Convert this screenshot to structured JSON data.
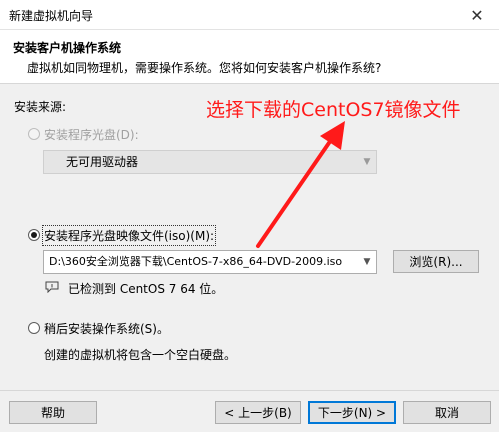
{
  "window": {
    "title": "新建虚拟机向导",
    "close_glyph": "✕"
  },
  "header": {
    "title": "安装客户机操作系统",
    "subtitle": "虚拟机如同物理机，需要操作系统。您将如何安装客户机操作系统?"
  },
  "source_label": "安装来源:",
  "options": {
    "disc": {
      "label": "安装程序光盘(D):",
      "dropdown_value": "无可用驱动器",
      "enabled": false
    },
    "iso": {
      "label": "安装程序光盘映像文件(iso)(M):",
      "path_value": "D:\\360安全浏览器下载\\CentOS-7-x86_64-DVD-2009.iso",
      "browse_label": "浏览(R)...",
      "detected_text": "已检测到 CentOS 7 64 位。",
      "selected": true
    },
    "later": {
      "label": "稍后安装操作系统(S)。",
      "description": "创建的虚拟机将包含一个空白硬盘。"
    }
  },
  "footer": {
    "help": "帮助",
    "back": "< 上一步(B)",
    "next": "下一步(N) >",
    "cancel": "取消"
  },
  "annotation": {
    "text": "选择下载的CentOS7镜像文件",
    "color": "#ff1a1a"
  }
}
